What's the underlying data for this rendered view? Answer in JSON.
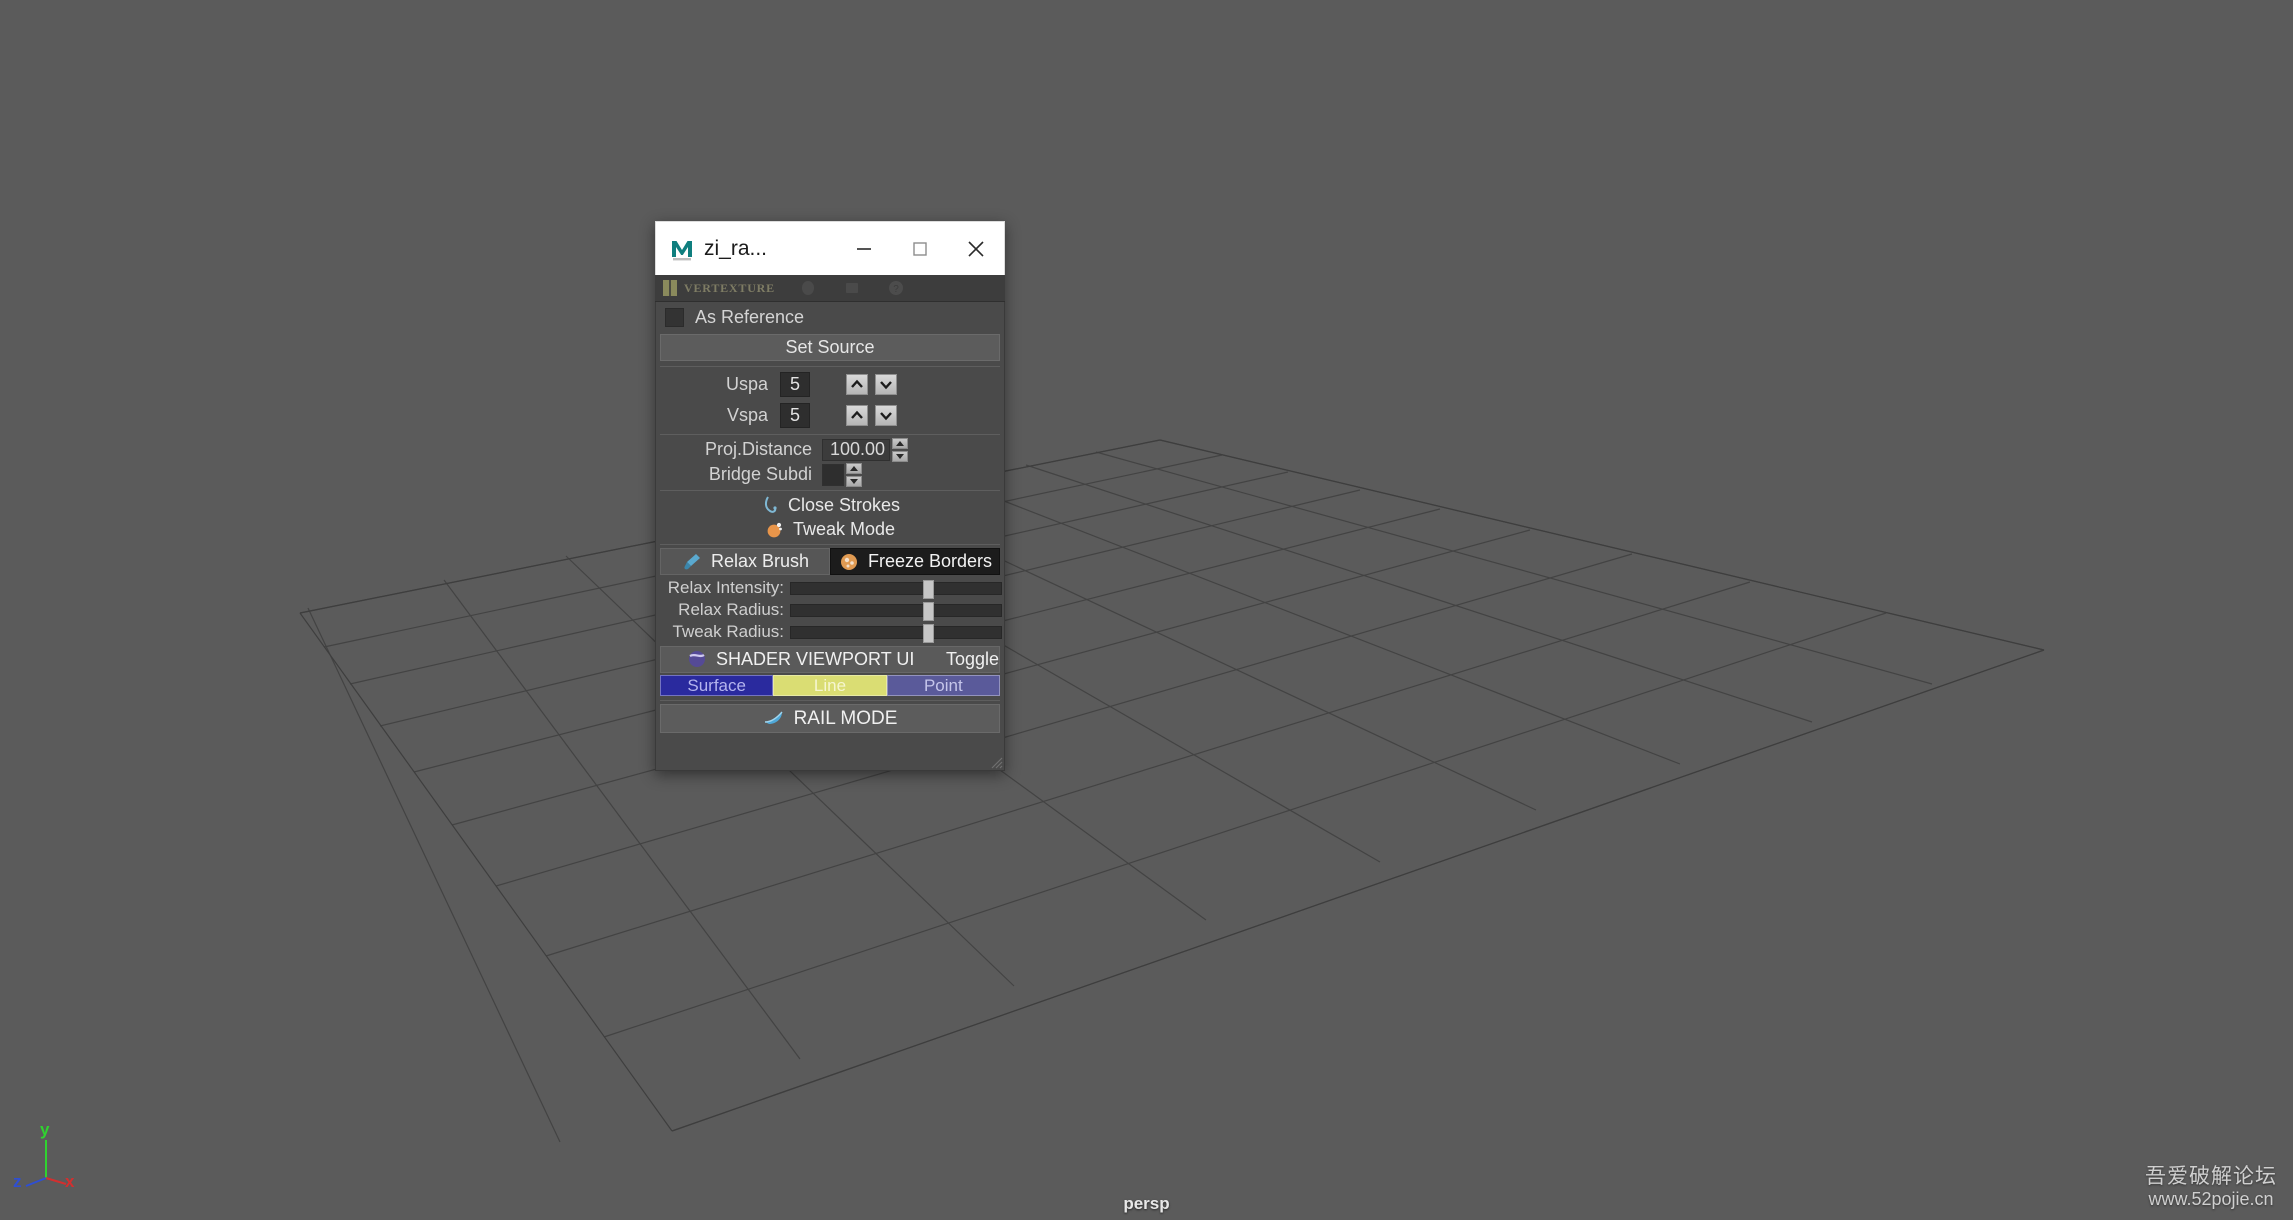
{
  "viewport": {
    "background_color": "#5b5b5b",
    "grid_line_color": "#3f3f3f",
    "camera_name": "persp",
    "axis": {
      "x_label": "x",
      "x_color": "#d32f2f",
      "y_label": "y",
      "y_color": "#2fd32f",
      "z_label": "z",
      "z_color": "#2f4fd3"
    },
    "watermark": {
      "line1": "吾爱破解论坛",
      "line2": "www.52pojie.cn"
    }
  },
  "window": {
    "title": "zi_ra...",
    "app_icon": "maya-m-logo-icon",
    "controls": {
      "minimize": "minimize-icon",
      "maximize": "maximize-icon",
      "close": "close-icon"
    }
  },
  "brand_bar": {
    "logo": "vertexture-leaf-logo-icon",
    "name": "VERTEXTURE",
    "icons": [
      "brand-icon-1",
      "brand-icon-2",
      "help-icon"
    ]
  },
  "panel": {
    "as_reference": {
      "label": "As Reference",
      "checked": false
    },
    "set_source": {
      "label": "Set Source"
    },
    "spinners": [
      {
        "label": "Uspa",
        "value": "5"
      },
      {
        "label": "Vspa",
        "value": "5"
      }
    ],
    "fields": [
      {
        "label": "Proj.Distance",
        "value": "100.00",
        "size": "big"
      },
      {
        "label": "Bridge Subdi",
        "value": "",
        "size": "small"
      }
    ],
    "actions": [
      {
        "label": "Close Strokes",
        "icon": "hook-stroke-icon",
        "icon_color": "#7fb8d4"
      },
      {
        "label": "Tweak Mode",
        "icon": "orange-blob-icon",
        "icon_color": "#e8954a"
      }
    ],
    "toggles": [
      {
        "label": "Relax Brush",
        "icon": "brush-icon",
        "state": "off"
      },
      {
        "label": "Freeze Borders",
        "icon": "freeze-sphere-icon",
        "state": "on"
      }
    ],
    "sliders": [
      {
        "label": "Relax Intensity:",
        "percent": 63
      },
      {
        "label": "Relax Radius:",
        "percent": 63
      },
      {
        "label": "Tweak Radius:",
        "percent": 63
      }
    ],
    "shader_bar": {
      "icon": "purple-sphere-icon",
      "label": "SHADER VIEWPORT UI",
      "toggle_label": "Toggle"
    },
    "display_modes": [
      {
        "label": "Surface",
        "bg": "#2a2a9e",
        "fg": "#b4b4ee"
      },
      {
        "label": "Line",
        "bg": "#dadd73",
        "fg": "#f6f6d0"
      },
      {
        "label": "Point",
        "bg": "#5a5a9a",
        "fg": "#c5c5ea"
      }
    ],
    "rail_mode": {
      "label": "RAIL MODE",
      "icon": "rail-wing-icon"
    }
  }
}
